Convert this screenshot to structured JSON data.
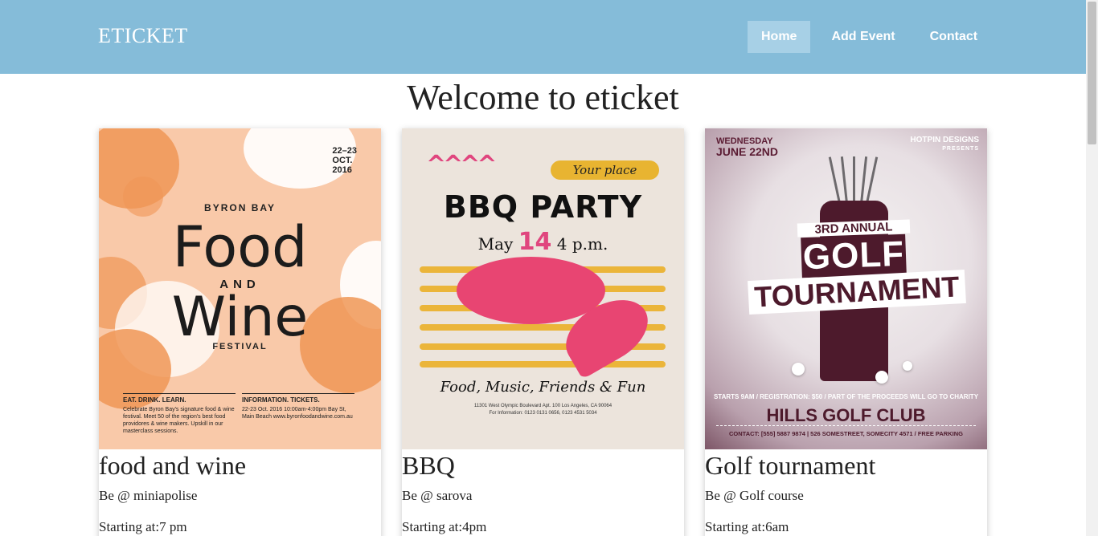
{
  "header": {
    "brand": "ETICKET",
    "nav": [
      {
        "label": "Home",
        "active": true
      },
      {
        "label": "Add Event",
        "active": false
      },
      {
        "label": "Contact",
        "active": false
      }
    ],
    "background_color": "#85bcd9"
  },
  "main": {
    "title": "Welcome to eticket",
    "events": [
      {
        "name": "food and wine",
        "venue": "Be @ miniapolise",
        "start": "Starting at:7 pm",
        "poster": {
          "date": "22–23\nOCT.\n2016",
          "top": "BYRON BAY",
          "line1": "Food",
          "line2": "AND",
          "line3": "Wine",
          "bottom": "FESTIVAL",
          "col1_head": "EAT. DRINK. LEARN.",
          "col1_text": "Celebrate Byron Bay's signature food & wine festival. Meet 50 of the region's best food providores & wine makers. Upskill in our masterclass sessions.",
          "col2_head": "INFORMATION. TICKETS.",
          "col2_text": "22-23 Oct. 2016 10:00am-4:00pm Bay St, Main Beach www.byronfoodandwine.com.au"
        }
      },
      {
        "name": "BBQ",
        "venue": "Be @ sarova",
        "start": "Starting at:4pm",
        "poster": {
          "place": "Your place",
          "headline": "BBQ PARTY",
          "date_month": "May",
          "date_day": "14",
          "date_time": "4 p.m.",
          "tagline": "Food, Music, Friends & Fun",
          "address": "11301 West Olympic Boulevard Apt. 100 Los Angeles, CA 90064\nFor Information: 0123 0131 0656, 0123 4531 5034"
        }
      },
      {
        "name": "Golf tournament",
        "venue": "Be @ Golf course",
        "start": "Starting at:6am",
        "poster": {
          "day": "WEDNESDAY",
          "date": "JUNE 22ND",
          "designer": "HOTPIN DESIGNS",
          "presents": "PRESENTS",
          "annual": "3RD ANNUAL",
          "golf": "GOLF",
          "tournament": "TOURNAMENT",
          "details": "STARTS 9AM / REGISTRATION: $50 / PART OF THE PROCEEDS WILL GO TO CHARITY",
          "club": "HILLS GOLF CLUB",
          "contact": "CONTACT: [555] 5887 9874 | 526 SOMESTREET, SOMECITY 4571 / FREE PARKING"
        }
      }
    ]
  }
}
